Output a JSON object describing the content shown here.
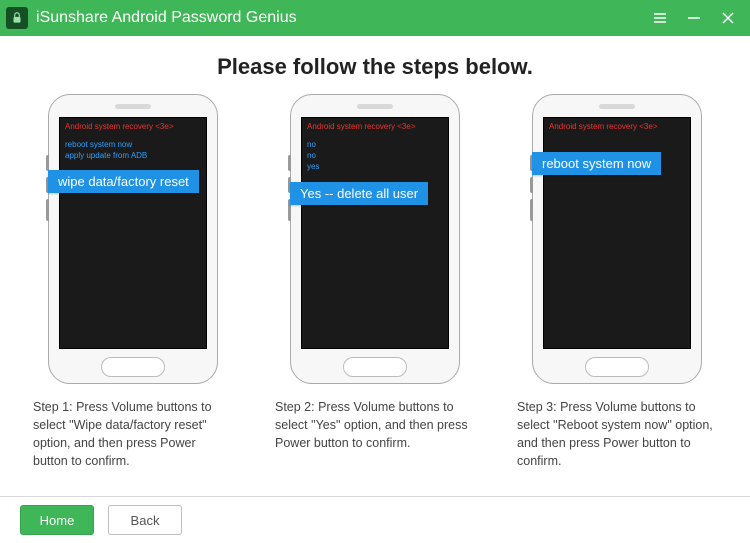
{
  "titlebar": {
    "title": "iSunshare Android Password Genius"
  },
  "heading": "Please follow the steps below.",
  "steps": [
    {
      "recovery_title": "Android system recovery <3e>",
      "lines": [
        "reboot system now",
        "apply update from ADB"
      ],
      "callout": "wipe data/factory reset",
      "caption": "Step 1: Press Volume buttons to select \"Wipe data/factory reset\" option, and then press Power button to confirm."
    },
    {
      "recovery_title": "Android system recovery <3e>",
      "lines": [
        "no",
        "no",
        "yes"
      ],
      "callout": "Yes -- delete all user",
      "caption": "Step 2: Press Volume buttons to select \"Yes\" option, and then press Power button to confirm."
    },
    {
      "recovery_title": "Android system recovery <3e>",
      "lines": [
        "···"
      ],
      "callout": "reboot system now",
      "caption": "Step 3: Press Volume buttons to select \"Reboot system now\" option, and then press Power button to confirm."
    }
  ],
  "footer": {
    "home_label": "Home",
    "back_label": "Back"
  },
  "colors": {
    "brand_green": "#3fb657",
    "callout_blue": "#1f92e6"
  }
}
